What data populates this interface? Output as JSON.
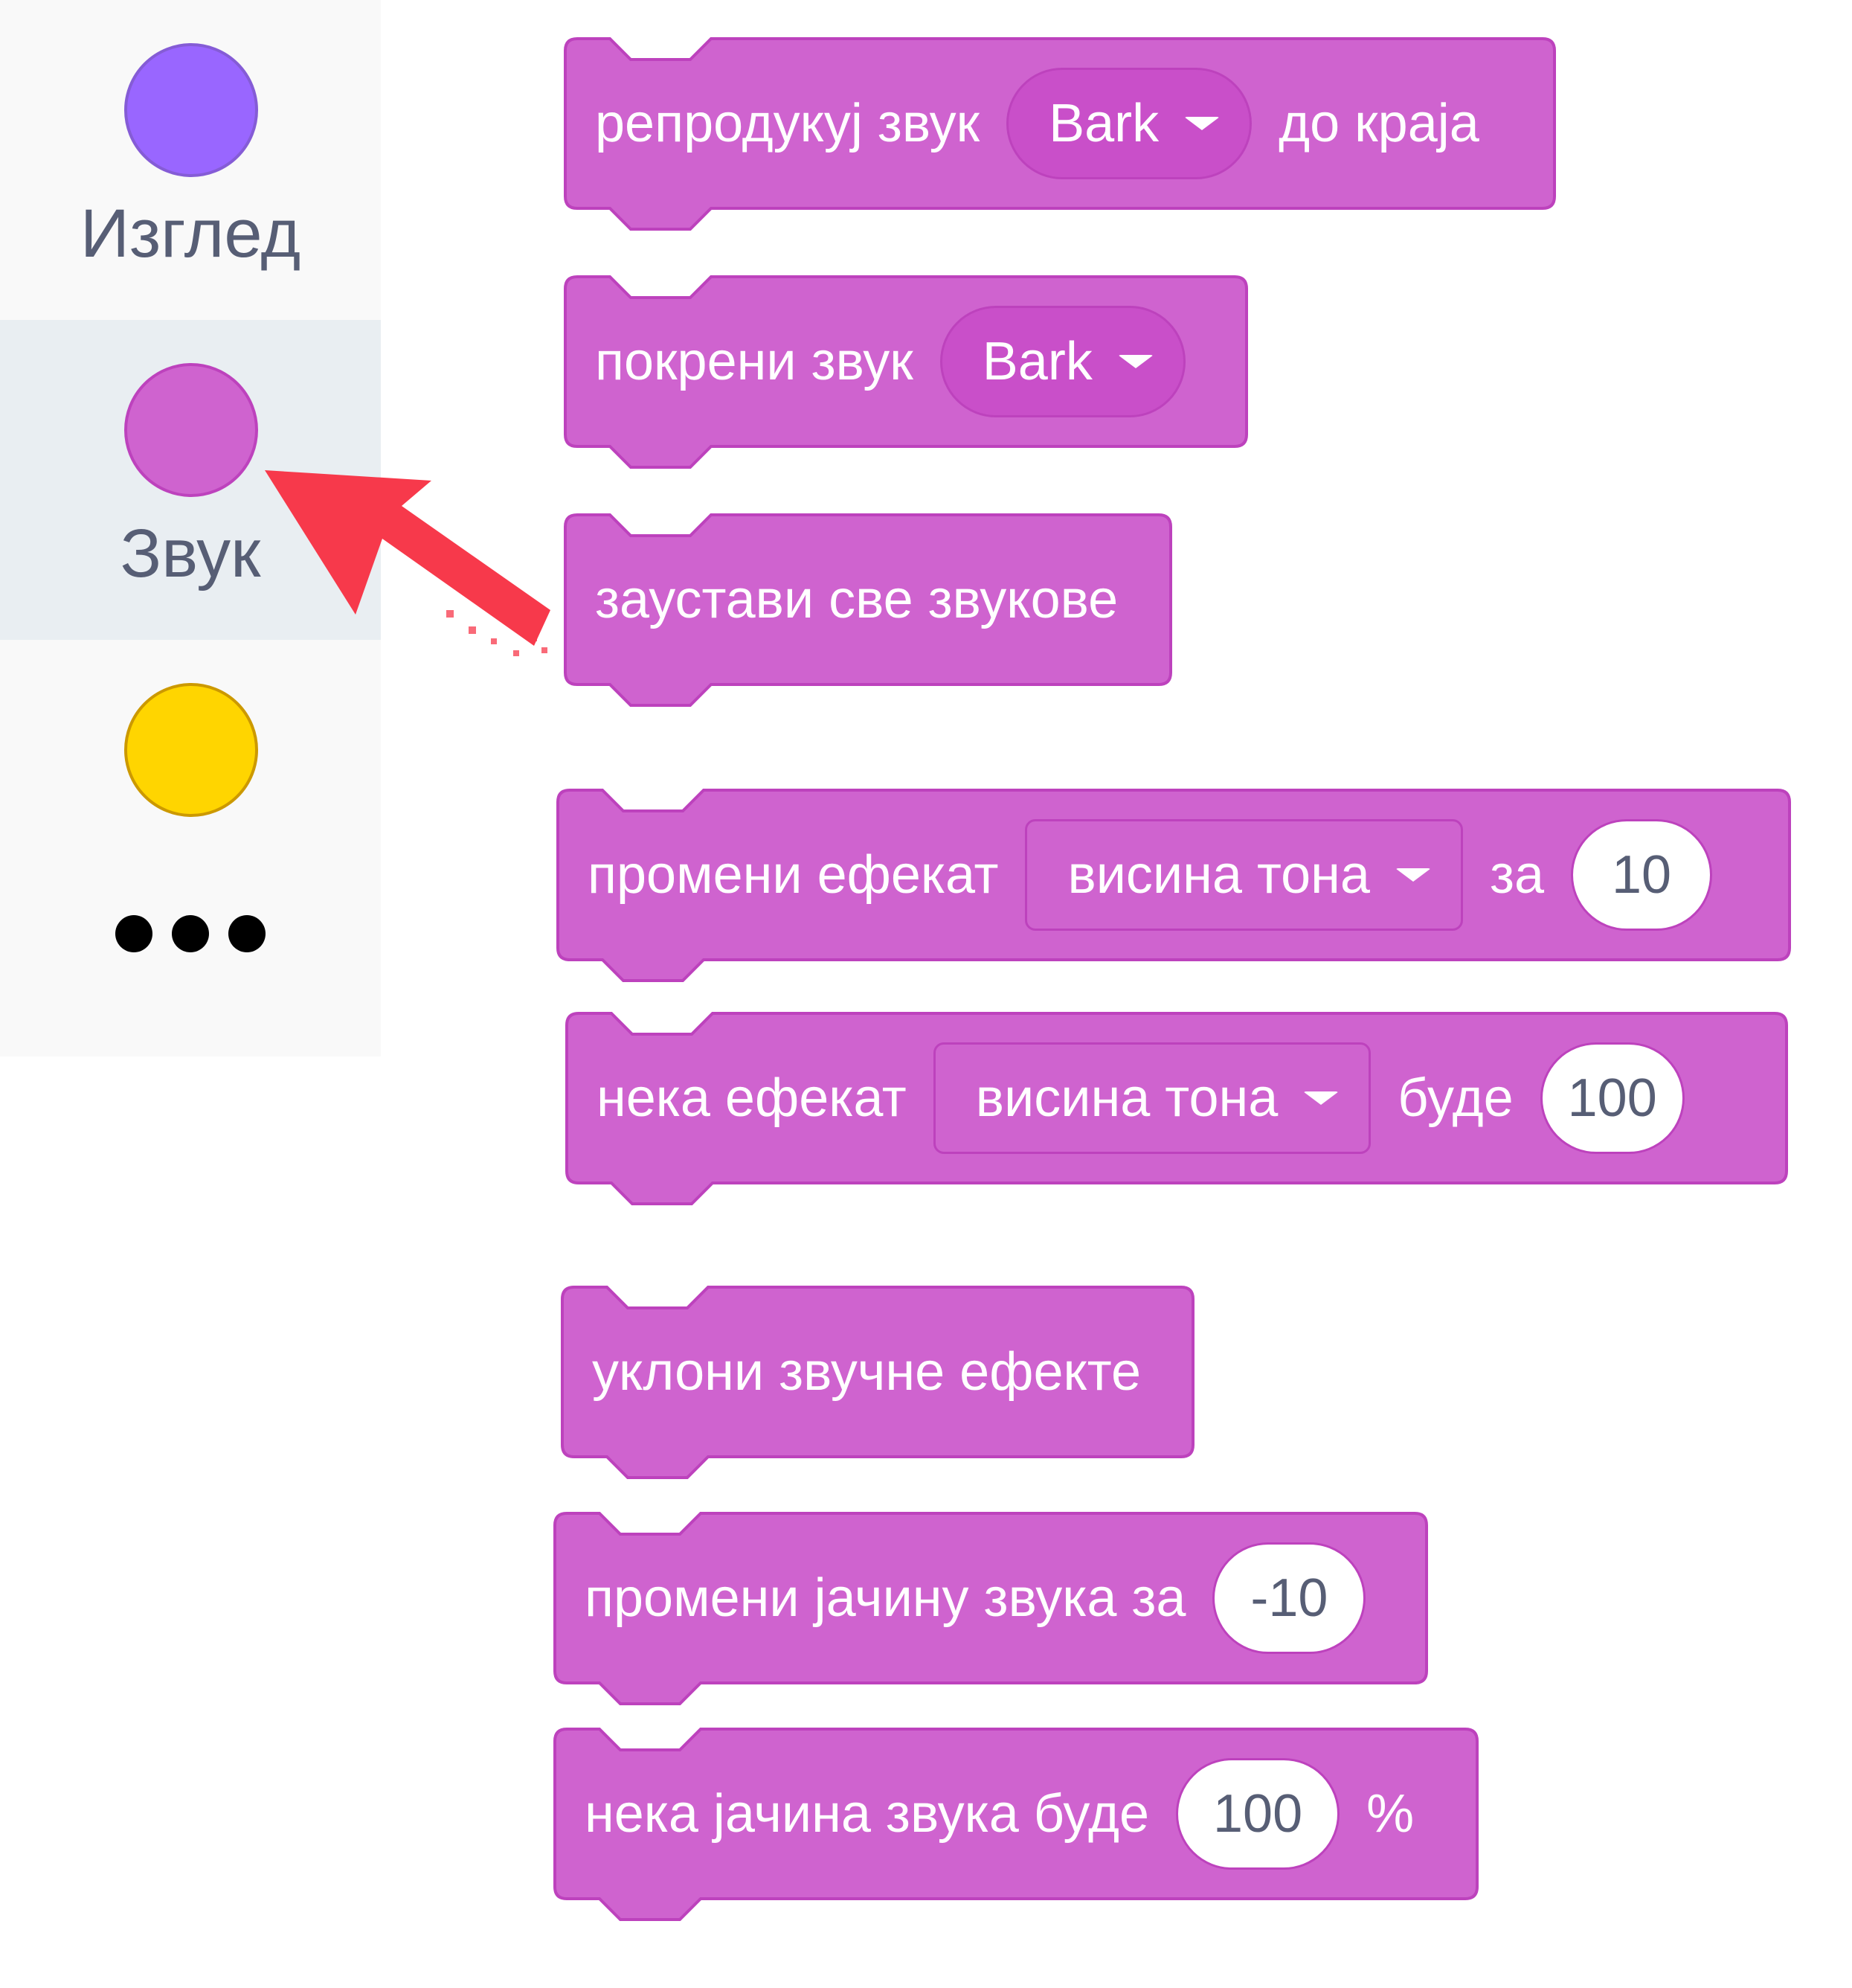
{
  "colors": {
    "sound_block": "#cf63cf",
    "sound_block_border": "#bd42bd",
    "looks_category": "#9966ff",
    "sound_category": "#cf63cf",
    "events_category": "#ffd500",
    "annotation_arrow": "#f7394b"
  },
  "sidebar": {
    "categories": [
      {
        "label": "Изглед",
        "icon": "looks-category-circle"
      },
      {
        "label": "Звук",
        "icon": "sound-category-circle",
        "selected": true
      },
      {
        "label": "",
        "icon": "events-category-circle"
      }
    ],
    "more_icon": "more-ellipsis-icon"
  },
  "blocks": {
    "play_until_done": {
      "text": "репродукуј звук",
      "sound": "Bark",
      "suffix": "до краја"
    },
    "start_sound": {
      "text": "покрени звук",
      "sound": "Bark"
    },
    "stop_all_sounds": {
      "text": "заустави све звукове"
    },
    "change_effect": {
      "text": "промени ефекат",
      "effect": "висина тона",
      "by": "за",
      "value": "10"
    },
    "set_effect": {
      "text": "нека ефекат",
      "effect": "висина тона",
      "to": "буде",
      "value": "100"
    },
    "clear_effects": {
      "text": "уклони звучне ефекте"
    },
    "change_volume": {
      "text": "промени јачину звука за",
      "value": "-10"
    },
    "set_volume": {
      "text": "нека јачина звука буде",
      "value": "100",
      "unit": "%"
    }
  },
  "annotation": {
    "icon": "pointer-arrow-icon"
  }
}
